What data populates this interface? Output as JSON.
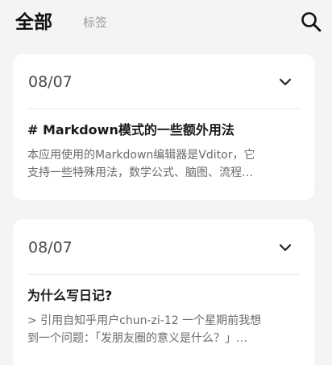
{
  "header": {
    "tab_all": "全部",
    "tab_tags": "标签",
    "search_icon": "search-icon"
  },
  "notes": [
    {
      "date": "08/07",
      "title": "# Markdown模式的一些额外用法",
      "excerpt_line1": "本应用使用的Markdown编辑器是Vditor，它",
      "excerpt_line2": "支持一些特殊用法，数学公式、脑图、流程…",
      "expand_icon": "chevron-down-icon"
    },
    {
      "date": "08/07",
      "title": "为什么写日记?",
      "excerpt_line1": "> 引用自知乎用户chun-zi-12 一个星期前我想",
      "excerpt_line2": "到一个问题：「发朋友圈的意义是什么？」…",
      "expand_icon": "chevron-down-icon"
    }
  ],
  "colors": {
    "background": "#f4f4f4",
    "card": "#ffffff",
    "text_primary": "#111111",
    "text_secondary": "#9a9a9a"
  }
}
